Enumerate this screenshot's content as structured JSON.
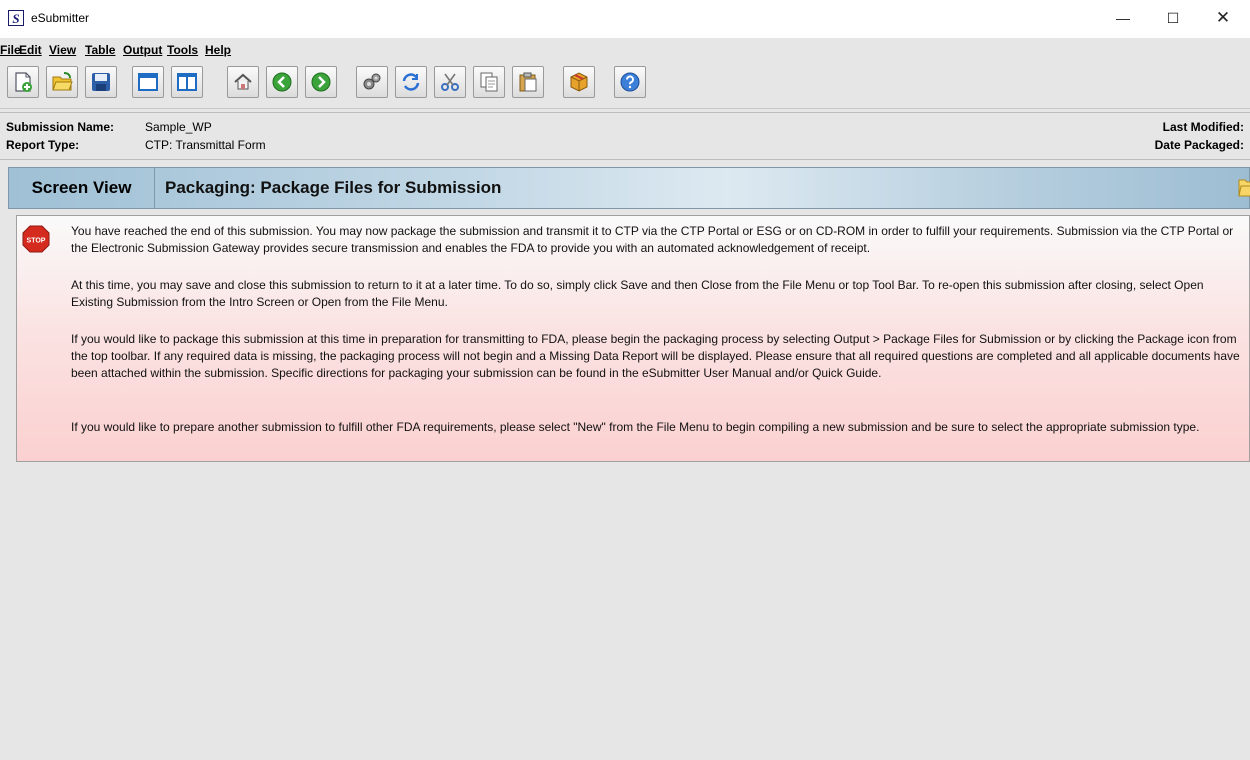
{
  "window": {
    "app_icon_letter": "S",
    "title": "eSubmitter",
    "minimize": "—",
    "maximize": "☐",
    "close": "✕"
  },
  "menu": [
    "File",
    "Edit",
    "View",
    "Table",
    "Output",
    "Tools",
    "Help"
  ],
  "toolbar_icons": [
    "new-icon",
    "open-icon",
    "save-icon",
    "window-icon",
    "panel-icon",
    "home-icon",
    "back-icon",
    "forward-icon",
    "settings-icon",
    "refresh-icon",
    "cut-icon",
    "copy-icon",
    "paste-icon",
    "package-icon",
    "help-icon"
  ],
  "info": {
    "submission_name_label": "Submission Name:",
    "submission_name": "Sample_WP",
    "report_type_label": "Report Type:",
    "report_type": "CTP: Transmittal Form",
    "last_modified_label": "Last Modified:",
    "date_packaged_label": "Date Packaged:"
  },
  "header": {
    "view_label": "Screen View",
    "title": "Packaging: Package Files for Submission"
  },
  "message": {
    "icon": "stop-sign-icon",
    "icon_text": "STOP",
    "paragraphs": [
      "You have reached the end of this submission.  You may now package the submission and transmit it to CTP via the CTP Portal or ESG or on CD-ROM in order to fulfill your requirements.  Submission via the CTP Portal or the Electronic Submission Gateway provides secure transmission and enables the FDA to provide you with an automated acknowledgement of receipt.",
      "At this time, you may save and close this submission to return to it at a later time.  To do so, simply click Save and then Close from the File Menu or top Tool Bar.  To re-open this submission after closing, select Open Existing Submission from the Intro Screen or Open from the File Menu.",
      "If you would like to package this submission at this time in preparation for transmitting to FDA, please begin the packaging process by selecting Output > Package Files for Submission or by clicking the Package icon from the top toolbar.  If any required data is missing, the packaging process will not begin and a Missing Data Report will be displayed.  Please ensure that all required questions are completed and all applicable documents have been attached within the submission.  Specific directions for packaging your submission can be found in the eSubmitter User Manual and/or Quick Guide.",
      "If you would like to prepare another submission to fulfill other FDA requirements, please select \"New\" from the File Menu to begin compiling a new submission and be sure to select the appropriate submission type."
    ]
  },
  "colors": {
    "header_gradient_start": "#9fc0d5",
    "message_bg_end": "#fbd0d0",
    "stop_red": "#d42b1e"
  }
}
